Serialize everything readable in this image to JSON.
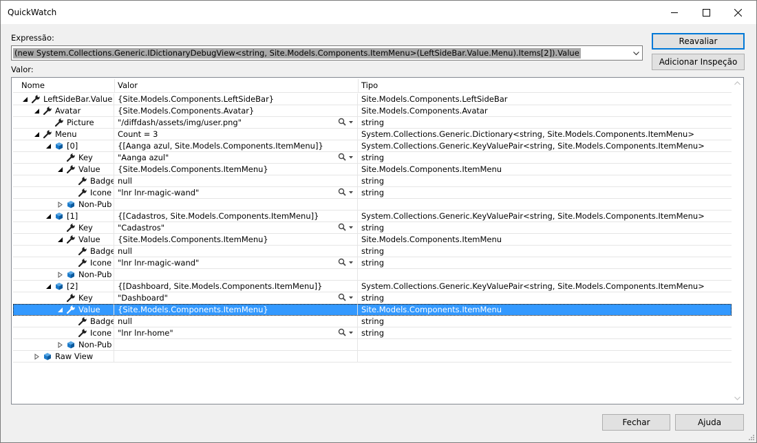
{
  "window": {
    "title": "QuickWatch",
    "labels": {
      "expression": "Expressão:",
      "value": "Valor:"
    },
    "expression": "(new System.Collections.Generic.IDictionaryDebugView<string, Site.Models.Components.ItemMenu>(LeftSideBar.Value.Menu).Items[2]).Value",
    "buttons": {
      "reevaluate": "Reavaliar",
      "add_watch": "Adicionar Inspeção",
      "close": "Fechar",
      "help": "Ajuda"
    },
    "columns": {
      "name": "Nome",
      "value": "Valor",
      "type": "Tipo"
    }
  },
  "rows": [
    {
      "name": "LeftSideBar.Value",
      "value": "{Site.Models.Components.LeftSideBar}",
      "type": "Site.Models.Components.LeftSideBar"
    },
    {
      "name": "Avatar",
      "value": "{Site.Models.Components.Avatar}",
      "type": "Site.Models.Components.Avatar"
    },
    {
      "name": "Picture",
      "value": "\"/diffdash/assets/img/user.png\"",
      "type": "string"
    },
    {
      "name": "Menu",
      "value": "Count = 3",
      "type": "System.Collections.Generic.Dictionary<string, Site.Models.Components.ItemMenu>"
    },
    {
      "name": "[0]",
      "value": "{[Aanga azul, Site.Models.Components.ItemMenu]}",
      "type": "System.Collections.Generic.KeyValuePair<string, Site.Models.Components.ItemMenu>"
    },
    {
      "name": "Key",
      "value": "\"Aanga azul\"",
      "type": "string"
    },
    {
      "name": "Value",
      "value": "{Site.Models.Components.ItemMenu}",
      "type": "Site.Models.Components.ItemMenu"
    },
    {
      "name": "Badge",
      "value": "null",
      "type": "string"
    },
    {
      "name": "Icone",
      "value": "\"lnr lnr-magic-wand\"",
      "type": "string"
    },
    {
      "name": "Non-Pub",
      "value": "",
      "type": ""
    },
    {
      "name": "[1]",
      "value": "{[Cadastros, Site.Models.Components.ItemMenu]}",
      "type": "System.Collections.Generic.KeyValuePair<string, Site.Models.Components.ItemMenu>"
    },
    {
      "name": "Key",
      "value": "\"Cadastros\"",
      "type": "string"
    },
    {
      "name": "Value",
      "value": "{Site.Models.Components.ItemMenu}",
      "type": "Site.Models.Components.ItemMenu"
    },
    {
      "name": "Badge",
      "value": "null",
      "type": "string"
    },
    {
      "name": "Icone",
      "value": "\"lnr lnr-magic-wand\"",
      "type": "string"
    },
    {
      "name": "Non-Pub",
      "value": "",
      "type": ""
    },
    {
      "name": "[2]",
      "value": "{[Dashboard, Site.Models.Components.ItemMenu]}",
      "type": "System.Collections.Generic.KeyValuePair<string, Site.Models.Components.ItemMenu>"
    },
    {
      "name": "Key",
      "value": "\"Dashboard\"",
      "type": "string"
    },
    {
      "name": "Value",
      "value": "{Site.Models.Components.ItemMenu}",
      "type": "Site.Models.Components.ItemMenu"
    },
    {
      "name": "Badge",
      "value": "null",
      "type": "string"
    },
    {
      "name": "Icone",
      "value": "\"lnr lnr-home\"",
      "type": "string"
    },
    {
      "name": "Non-Pub",
      "value": "",
      "type": ""
    },
    {
      "name": "Raw View",
      "value": "",
      "type": ""
    }
  ],
  "colors": {
    "selection": "#3399ff",
    "default_button_border": "#0078d7",
    "property_icon": "#1e1e1e",
    "member_icon": "#1c7ac9"
  }
}
